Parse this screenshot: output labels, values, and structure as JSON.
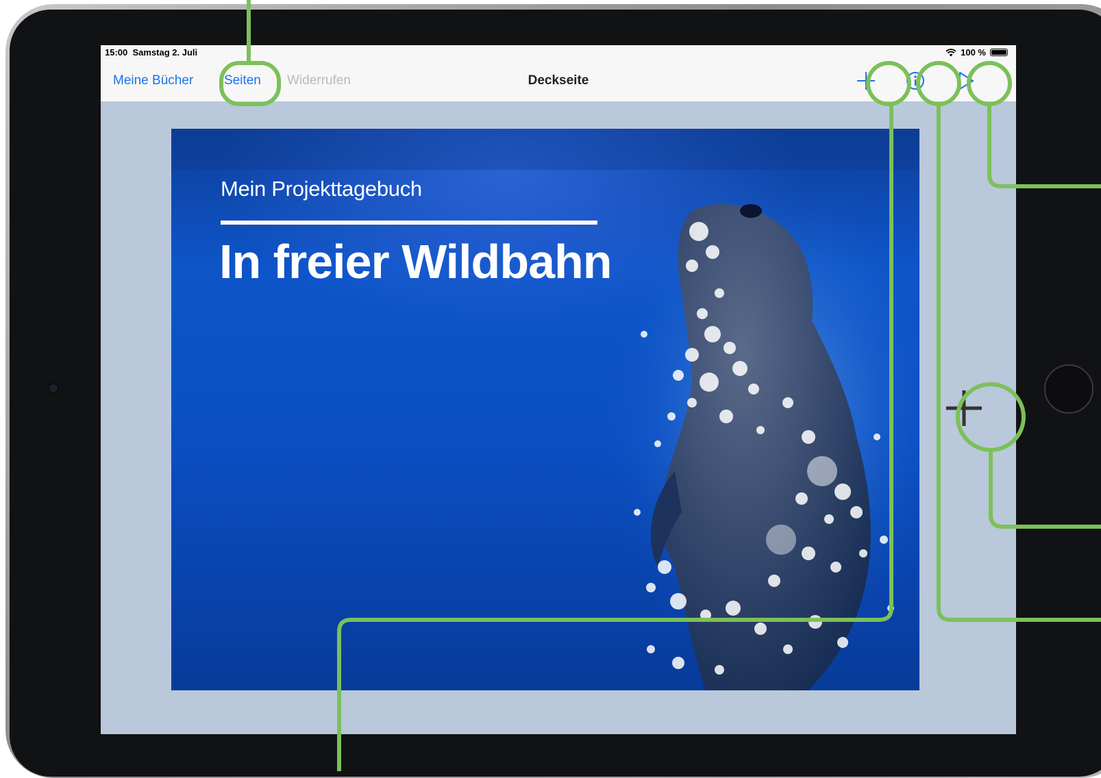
{
  "status_bar": {
    "time": "15:00",
    "date": "Samstag 2. Juli",
    "battery": "100 %"
  },
  "navbar": {
    "my_books": "Meine Bücher",
    "pages": "Seiten",
    "undo": "Widerrufen",
    "title": "Deckseite",
    "icons": [
      "add-icon",
      "info-icon",
      "play-icon"
    ]
  },
  "page": {
    "subtitle": "Mein Projekttagebuch",
    "headline": "In freier Wildbahn"
  },
  "colors": {
    "accent": "#1a73e8",
    "callout": "#7cc05a",
    "page_blue": "#0d55c9"
  }
}
